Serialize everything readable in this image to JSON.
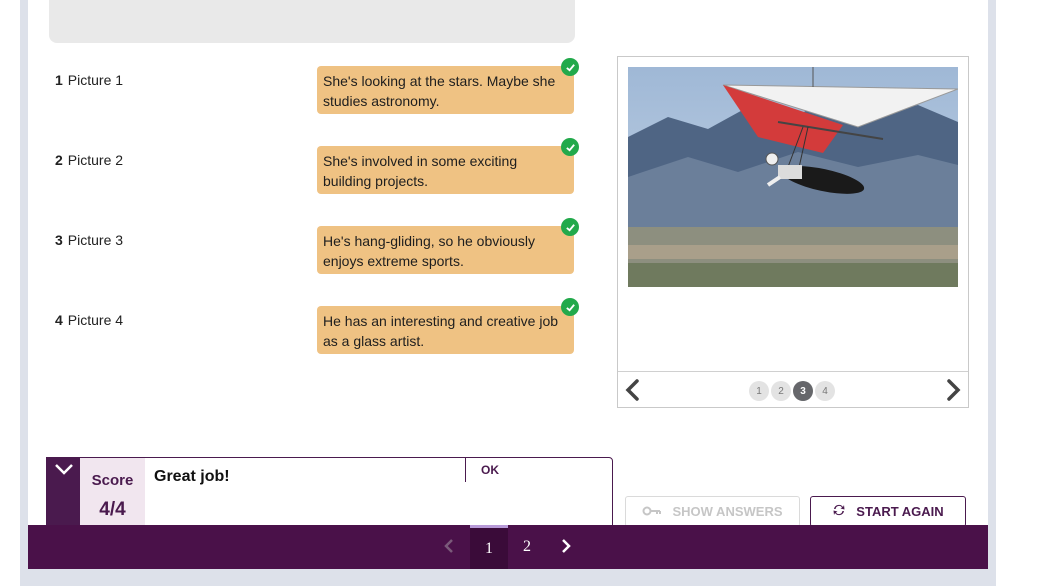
{
  "items": [
    {
      "num": "1",
      "label": "Picture 1",
      "answer": "She's looking at the stars. Maybe she studies astronomy."
    },
    {
      "num": "2",
      "label": "Picture 2",
      "answer": "She's involved in some exciting building projects."
    },
    {
      "num": "3",
      "label": "Picture 3",
      "answer": "He's hang-gliding, so he obviously enjoys extreme sports."
    },
    {
      "num": "4",
      "label": "Picture 4",
      "answer": "He has an interesting and creative job as a glass artist."
    }
  ],
  "gallery": {
    "photo_subject": "hang-glider over mountains",
    "dots": [
      "1",
      "2",
      "3",
      "4"
    ],
    "active_dot": "3"
  },
  "feedback": {
    "score_label": "Score",
    "score_value": "4/4",
    "message": "Great job!",
    "ok_label": "OK"
  },
  "actions": {
    "show_answers": "SHOW ANSWERS",
    "start_again": "START AGAIN"
  },
  "pagination": {
    "pages": [
      "1",
      "2"
    ],
    "current": "1"
  },
  "colors": {
    "brand": "#4a1149",
    "answer_bg": "#efc283",
    "correct": "#22a94b"
  }
}
